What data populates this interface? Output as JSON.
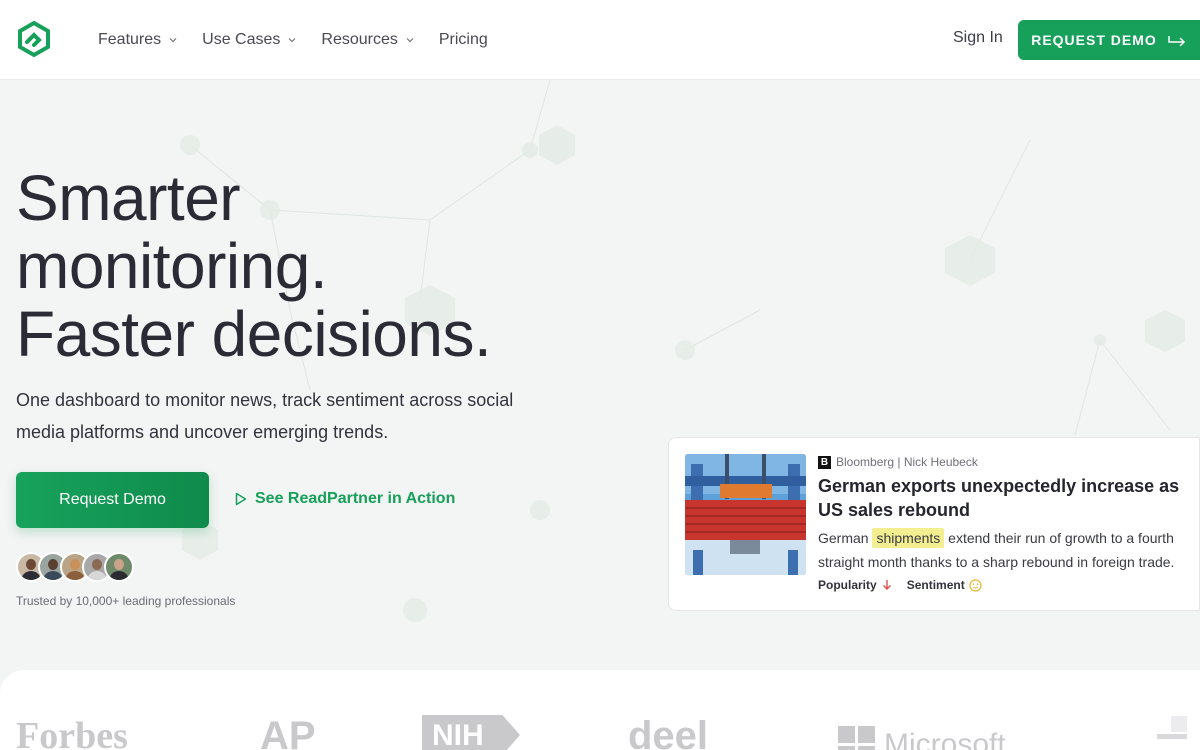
{
  "nav": {
    "menu": [
      {
        "label": "Features",
        "dropdown": true
      },
      {
        "label": "Use Cases",
        "dropdown": true
      },
      {
        "label": "Resources",
        "dropdown": true
      },
      {
        "label": "Pricing",
        "dropdown": false
      }
    ],
    "sign_in": "Sign In",
    "request_demo": "REQUEST DEMO"
  },
  "hero": {
    "title_lines": [
      "Smarter",
      "monitoring.",
      "Faster decisions."
    ],
    "subtitle": "One dashboard to monitor news, track sentiment across social media platforms and uncover emerging trends.",
    "primary_button": "Request Demo",
    "secondary_link": "See ReadPartner in Action",
    "trusted": "Trusted by 10,000+ leading professionals"
  },
  "news_card": {
    "source_badge": "B",
    "source": "Bloomberg | Nick Heubeck",
    "title": "German exports unexpectedly increase as US sales rebound",
    "body_before": "German",
    "body_highlight": "shipments",
    "body_after": "extend their run of growth to a fourth straight month thanks to a sharp rebound in foreign trade.",
    "popularity_label": "Popularity",
    "sentiment_label": "Sentiment"
  },
  "logos": [
    "Forbes",
    "AP",
    "NIH",
    "deel",
    "Microsoft"
  ],
  "colors": {
    "accent": "#16a05a",
    "highlight": "#f3ee8f",
    "down_arrow": "#e05050",
    "sentiment_face": "#e8b531"
  },
  "icons": [
    "logo-icon",
    "chevron-down-icon",
    "arrow-right-icon",
    "play-icon",
    "arrow-down-icon",
    "neutral-face-icon",
    "microsoft-icon"
  ]
}
